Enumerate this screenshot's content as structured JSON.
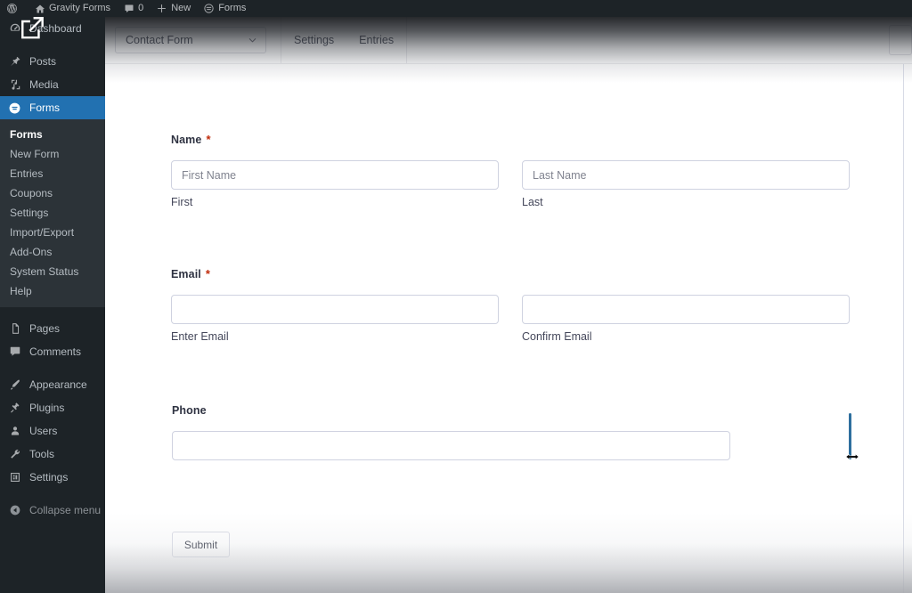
{
  "adminbar": {
    "items": [
      {
        "icon": "wordpress-logo-icon",
        "label": ""
      },
      {
        "icon": "home-icon",
        "label": "Gravity Forms"
      },
      {
        "icon": "comment-icon",
        "label": "0"
      },
      {
        "icon": "plus-icon",
        "label": "New"
      },
      {
        "icon": "gravityforms-icon",
        "label": "Forms"
      }
    ]
  },
  "sidebar": {
    "items": [
      {
        "label": "Dashboard",
        "icon": "dashboard-icon",
        "current": false
      },
      {
        "label": "Posts",
        "icon": "pin-icon",
        "current": false
      },
      {
        "label": "Media",
        "icon": "media-icon",
        "current": false
      },
      {
        "label": "Forms",
        "icon": "gravityforms-icon",
        "current": true
      },
      {
        "label": "Pages",
        "icon": "pages-icon",
        "current": false
      },
      {
        "label": "Comments",
        "icon": "comment-icon",
        "current": false
      },
      {
        "label": "Appearance",
        "icon": "brush-icon",
        "current": false
      },
      {
        "label": "Plugins",
        "icon": "plugin-icon",
        "current": false
      },
      {
        "label": "Users",
        "icon": "users-icon",
        "current": false
      },
      {
        "label": "Tools",
        "icon": "wrench-icon",
        "current": false
      },
      {
        "label": "Settings",
        "icon": "settings-icon",
        "current": false
      },
      {
        "label": "Collapse menu",
        "icon": "collapse-icon",
        "current": false
      }
    ],
    "submenu": [
      {
        "label": "Forms",
        "current": true
      },
      {
        "label": "New Form",
        "current": false
      },
      {
        "label": "Entries",
        "current": false
      },
      {
        "label": "Coupons",
        "current": false
      },
      {
        "label": "Settings",
        "current": false
      },
      {
        "label": "Import/Export",
        "current": false
      },
      {
        "label": "Add-Ons",
        "current": false
      },
      {
        "label": "System Status",
        "current": false
      },
      {
        "label": "Help",
        "current": false
      }
    ]
  },
  "header": {
    "form_selector": "Contact Form",
    "tabs": [
      {
        "label": "Settings"
      },
      {
        "label": "Entries"
      }
    ]
  },
  "form": {
    "fields": [
      {
        "label": "Name",
        "required": true,
        "required_mark": "*",
        "inputs": [
          {
            "placeholder": "First Name",
            "value": "",
            "sublabel": "First"
          },
          {
            "placeholder": "Last Name",
            "value": "",
            "sublabel": "Last"
          }
        ]
      },
      {
        "label": "Email",
        "required": true,
        "required_mark": "*",
        "inputs": [
          {
            "placeholder": "",
            "value": "",
            "sublabel": "Enter Email"
          },
          {
            "placeholder": "",
            "value": "",
            "sublabel": "Confirm Email"
          }
        ]
      },
      {
        "label": "Phone",
        "required": false,
        "required_mark": "",
        "inputs": [
          {
            "placeholder": "",
            "value": "",
            "sublabel": ""
          }
        ]
      }
    ],
    "submit_label": "Submit"
  },
  "colors": {
    "admin_dark": "#1d2327",
    "submenu_dark": "#2c3338",
    "accent_blue": "#2271b1",
    "required_red": "#c02b0a",
    "resize_handle_blue": "#2e6f9e",
    "input_border": "#cfd2e0",
    "text_dark": "#2f3342"
  },
  "cursor": {
    "type": "horizontal-resize-cursor",
    "overlay_icon": "share-export-icon"
  }
}
